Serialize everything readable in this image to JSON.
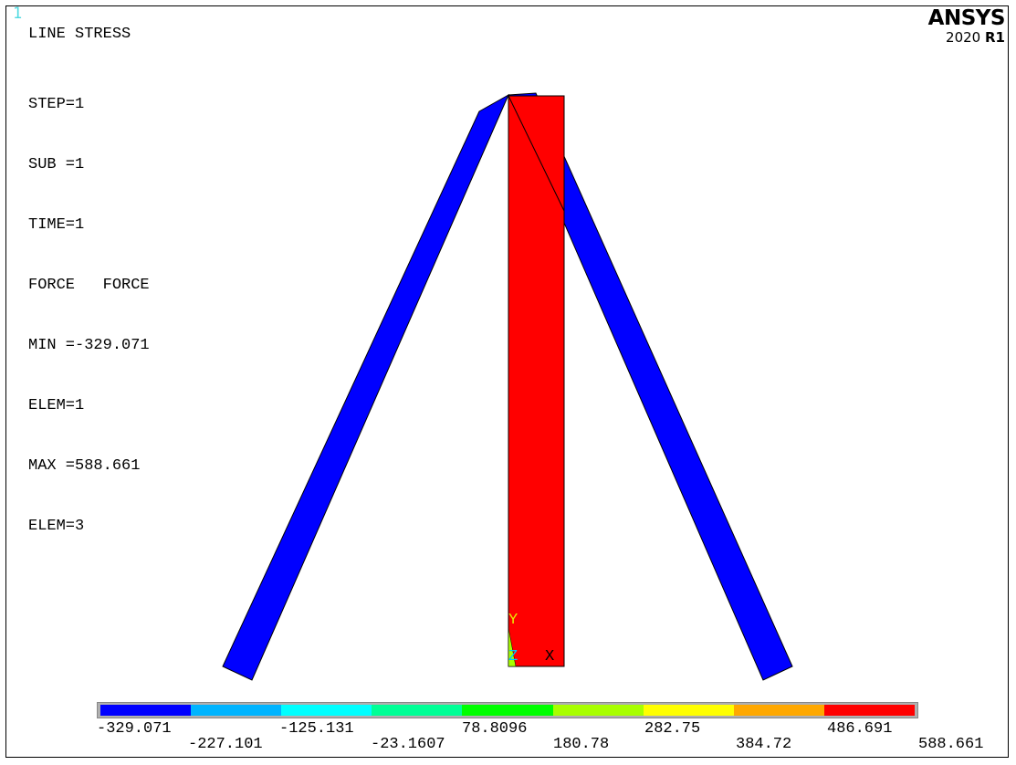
{
  "window_number": "1",
  "info": {
    "title": "LINE STRESS",
    "lines": [
      "STEP=1",
      "SUB =1",
      "TIME=1",
      "FORCE   FORCE",
      "MIN =-329.071",
      "ELEM=1",
      "MAX =588.661",
      "ELEM=3"
    ]
  },
  "logo": {
    "brand": "ANSYS",
    "year": "2020",
    "release": "R1"
  },
  "triad": {
    "y": "Y",
    "z": "Z",
    "x": "X"
  },
  "colors": {
    "compression": "#0000ff",
    "tension": "#ff0000",
    "triad_label": "#e8e800"
  },
  "legend": {
    "colors": [
      "#0000ff",
      "#00b4ff",
      "#00ffff",
      "#00ff96",
      "#00ff00",
      "#a8ff00",
      "#ffff00",
      "#ffa800",
      "#ff0000"
    ],
    "top_labels": [
      "-329.071",
      "-125.131",
      "78.8096",
      "282.75",
      "486.691"
    ],
    "bottom_labels": [
      "-227.101",
      "-23.1607",
      "180.78",
      "384.72",
      "588.661"
    ]
  }
}
